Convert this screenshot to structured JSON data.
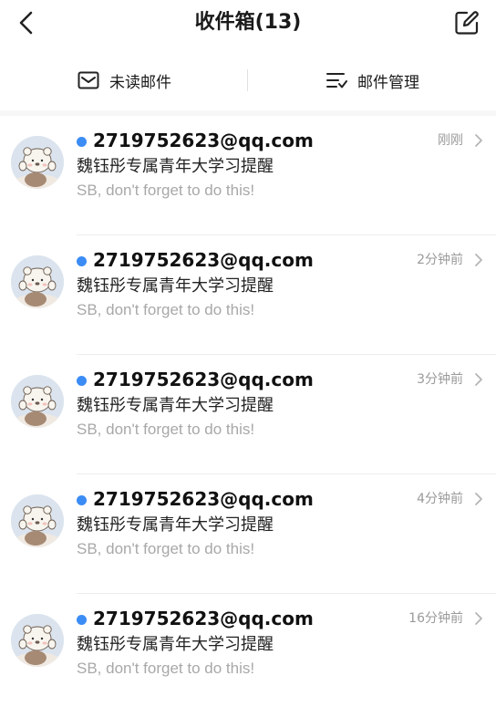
{
  "header": {
    "title": "收件箱(13)"
  },
  "toolbar": {
    "unread_label": "未读邮件",
    "manage_label": "邮件管理"
  },
  "mails": [
    {
      "sender": "2719752623@qq.com",
      "subject": "魏钰彤专属青年大学习提醒",
      "preview": "SB, don't forget to do this!",
      "time": "刚刚",
      "unread": true
    },
    {
      "sender": "2719752623@qq.com",
      "subject": "魏钰彤专属青年大学习提醒",
      "preview": "SB, don't forget to do this!",
      "time": "2分钟前",
      "unread": true
    },
    {
      "sender": "2719752623@qq.com",
      "subject": "魏钰彤专属青年大学习提醒",
      "preview": "SB, don't forget to do this!",
      "time": "3分钟前",
      "unread": true
    },
    {
      "sender": "2719752623@qq.com",
      "subject": "魏钰彤专属青年大学习提醒",
      "preview": "SB, don't forget to do this!",
      "time": "4分钟前",
      "unread": true
    },
    {
      "sender": "2719752623@qq.com",
      "subject": "魏钰彤专属青年大学习提醒",
      "preview": "SB, don't forget to do this!",
      "time": "16分钟前",
      "unread": true
    }
  ],
  "icons": {
    "back": "chevron-left-icon",
    "compose": "compose-icon",
    "unread": "envelope-icon",
    "manage": "filter-list-icon",
    "row_arrow": "chevron-right-icon"
  },
  "colors": {
    "unread_dot": "#3b8cf5",
    "preview_text": "#a8a8a8",
    "time_text": "#9a9a9a"
  }
}
